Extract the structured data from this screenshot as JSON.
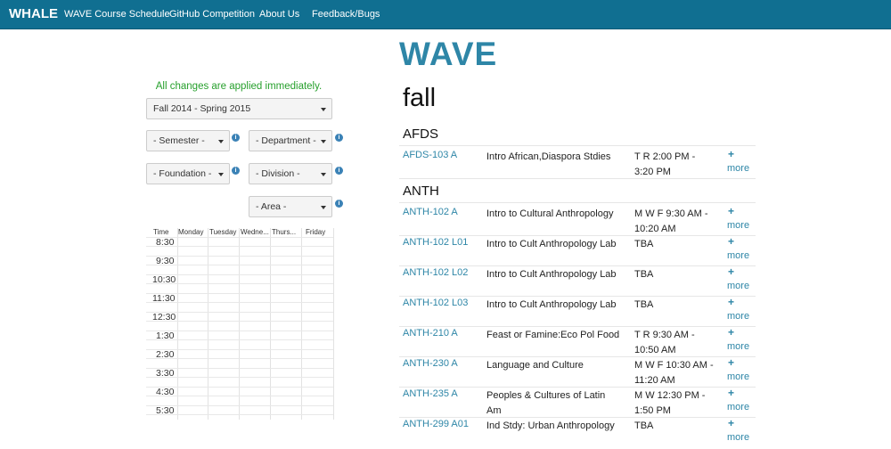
{
  "nav": {
    "brand": "WHALE",
    "links": [
      "WAVE Course Schedule",
      "GitHub Competition",
      "About Us",
      "Feedback/Bugs"
    ]
  },
  "logo": "WAVE",
  "notice": "All changes are applied immediately.",
  "filters": {
    "term": "Fall 2014 - Spring 2015",
    "semester": "- Semester -",
    "department": "- Department -",
    "foundation": "- Foundation -",
    "division": "- Division -",
    "area": "- Area -",
    "info_glyph": "i"
  },
  "calendar": {
    "headers": [
      "Time",
      "Monday",
      "Tuesday",
      "Wedne...",
      "Thurs...",
      "Friday"
    ],
    "times": [
      "8:30",
      "9:30",
      "10:30",
      "11:30",
      "12:30",
      "1:30",
      "2:30",
      "3:30",
      "4:30",
      "5:30"
    ]
  },
  "term_title": "fall",
  "more_label": "more",
  "plus_label": "+",
  "departments": [
    {
      "name": "AFDS",
      "courses": [
        {
          "code": "AFDS-103 A",
          "title": "Intro African,Diaspora Stdies",
          "time": "T R 2:00 PM - 3:20 PM"
        }
      ]
    },
    {
      "name": "ANTH",
      "courses": [
        {
          "code": "ANTH-102 A",
          "title": "Intro to Cultural Anthropology",
          "time": "M W F 9:30 AM - 10:20 AM"
        },
        {
          "code": "ANTH-102 L01",
          "title": "Intro to Cult Anthropology Lab",
          "time": "TBA"
        },
        {
          "code": "ANTH-102 L02",
          "title": "Intro to Cult Anthropology Lab",
          "time": "TBA"
        },
        {
          "code": "ANTH-102 L03",
          "title": "Intro to Cult Anthropology Lab",
          "time": "TBA"
        },
        {
          "code": "ANTH-210 A",
          "title": "Feast or Famine:Eco Pol Food",
          "time": "T R 9:30 AM - 10:50 AM"
        },
        {
          "code": "ANTH-230 A",
          "title": "Language and Culture",
          "time": "M W F 10:30 AM - 11:20 AM"
        },
        {
          "code": "ANTH-235 A",
          "title": "Peoples & Cultures of Latin Am",
          "time": "M W 12:30 PM - 1:50 PM"
        },
        {
          "code": "ANTH-299 A01",
          "title": "Ind Stdy: Urban Anthropology",
          "time": "TBA"
        }
      ]
    }
  ]
}
